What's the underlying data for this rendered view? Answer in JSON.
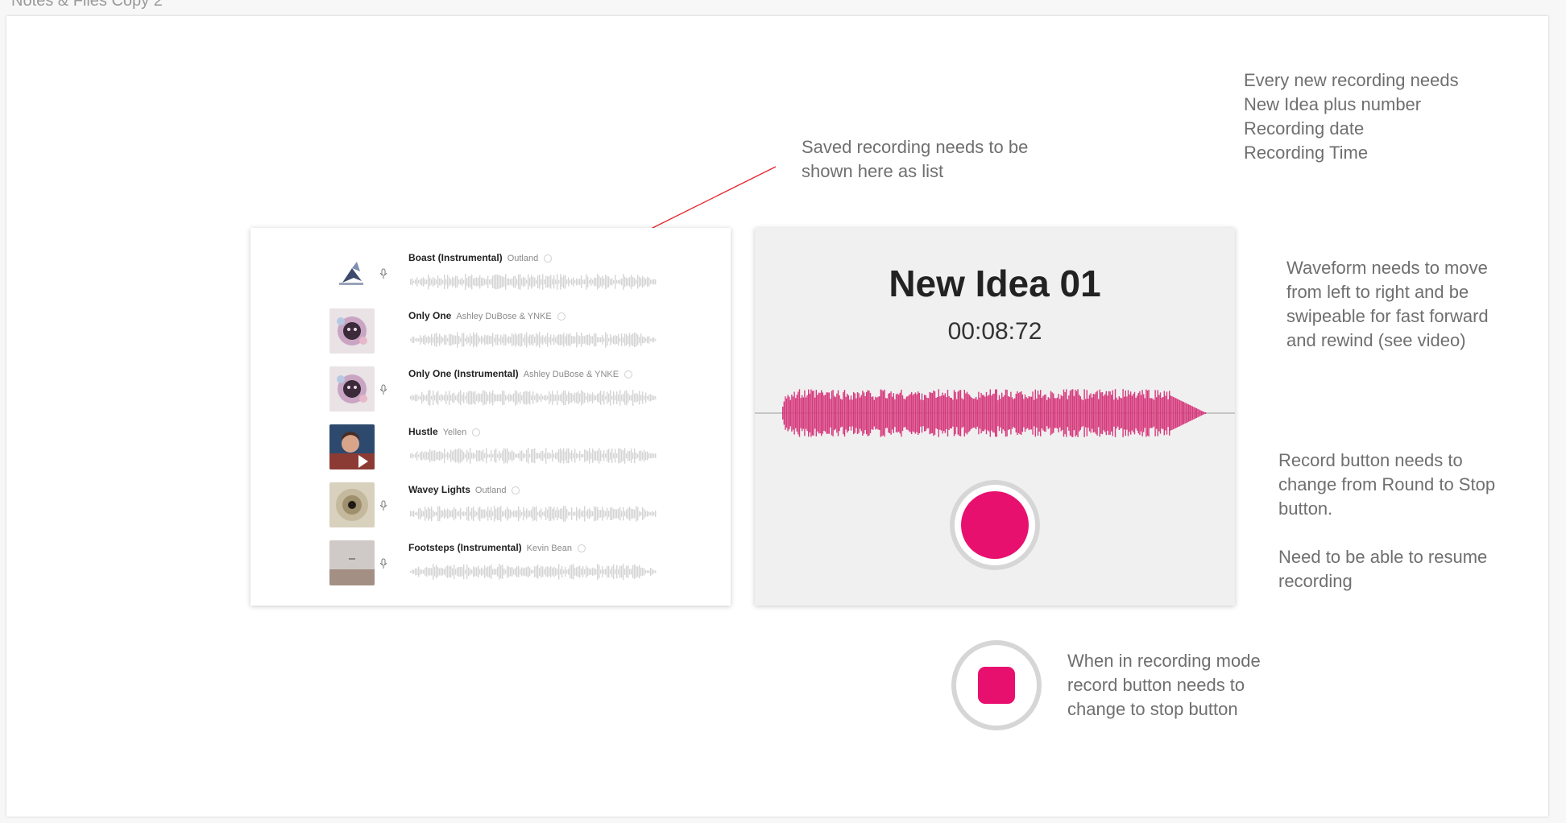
{
  "artboard": {
    "title": "Notes & Files Copy 2"
  },
  "notes": {
    "saved_list": "Saved recording needs to be\nshown here as list",
    "new_recording": "Every new recording needs\nNew Idea plus number\nRecording date\nRecording Time",
    "waveform": "Waveform needs to move\nfrom left to right and be\nswipeable for fast forward\nand rewind (see video)",
    "record_button": "Record button needs to\nchange from Round to Stop\nbutton.\n\nNeed to be able to resume\nrecording",
    "stop_button": "When in recording mode\nrecord button needs to\nchange to stop button"
  },
  "tracks": [
    {
      "title": "Boast (Instrumental)",
      "artist": "Outland",
      "thumb": "butterfly-art"
    },
    {
      "title": "Only One",
      "artist": "Ashley DuBose & YNKE",
      "thumb": "floral-portrait-art"
    },
    {
      "title": "Only One (Instrumental)",
      "artist": "Ashley DuBose & YNKE",
      "thumb": "floral-portrait-art"
    },
    {
      "title": "Hustle",
      "artist": "Yellen",
      "thumb": "portrait-photo"
    },
    {
      "title": "Wavey Lights",
      "artist": "Outland",
      "thumb": "spiral-photo"
    },
    {
      "title": "Footsteps (Instrumental)",
      "artist": "Kevin Bean",
      "thumb": "grey-photo"
    }
  ],
  "recorder": {
    "title": "New Idea 01",
    "time": "00:08:72",
    "accent_color": "#e8106f",
    "waveform_color": "#d63a7d"
  }
}
